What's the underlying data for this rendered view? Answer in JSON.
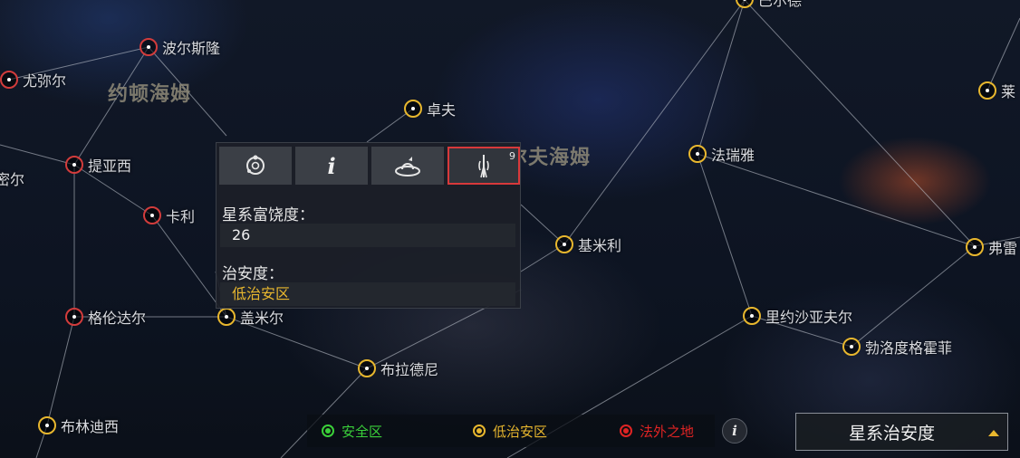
{
  "map": {
    "regions": [
      {
        "id": "r1",
        "name": "约顿海姆"
      },
      {
        "id": "r2",
        "name": "尔夫海姆"
      }
    ],
    "systems": [
      {
        "id": "s-bo",
        "name": "波尔斯隆",
        "security": "red"
      },
      {
        "id": "s-you",
        "name": "尤弥尔",
        "security": "red"
      },
      {
        "id": "s-mi",
        "name": "密尔",
        "security": "none"
      },
      {
        "id": "s-ti",
        "name": "提亚西",
        "security": "red"
      },
      {
        "id": "s-ka",
        "name": "卡利",
        "security": "red"
      },
      {
        "id": "s-ge",
        "name": "格伦达尔",
        "security": "red"
      },
      {
        "id": "s-gai",
        "name": "盖米尔",
        "security": "yellow"
      },
      {
        "id": "s-bulin",
        "name": "布林迪西",
        "security": "yellow"
      },
      {
        "id": "s-zhuo",
        "name": "卓夫",
        "security": "yellow"
      },
      {
        "id": "s-ji",
        "name": "基米利",
        "security": "yellow"
      },
      {
        "id": "s-fa",
        "name": "法瑞雅",
        "security": "yellow"
      },
      {
        "id": "s-li",
        "name": "里约沙亚夫尔",
        "security": "yellow"
      },
      {
        "id": "s-boluo",
        "name": "勃洛度格霍菲",
        "security": "yellow"
      },
      {
        "id": "s-bula",
        "name": "布拉德尼",
        "security": "yellow"
      },
      {
        "id": "s-fu",
        "name": "弗雷",
        "security": "yellow"
      },
      {
        "id": "s-lai",
        "name": "莱",
        "security": "yellow"
      },
      {
        "id": "s-top",
        "name": "巴尔德",
        "security": "yellow"
      }
    ]
  },
  "panel": {
    "tabs": [
      {
        "name": "tab-orbit",
        "icon": "orbit-icon"
      },
      {
        "name": "tab-info",
        "icon": "info-icon",
        "glyph": "i"
      },
      {
        "name": "tab-planet",
        "icon": "planet-icon"
      },
      {
        "name": "tab-security",
        "icon": "signal-tower-icon",
        "badge": "9",
        "active": true
      }
    ],
    "richness_label": "星系富饶度：",
    "richness_value": "26",
    "security_label": "治安度：",
    "security_value": "低治安区"
  },
  "legend": {
    "safe": {
      "label": "安全区",
      "color": "#3ad03a"
    },
    "low": {
      "label": "低治安区",
      "color": "#e8b72e"
    },
    "lawless": {
      "label": "法外之地",
      "color": "#e02424"
    },
    "info_glyph": "i"
  },
  "mode_select": {
    "label": "星系治安度"
  }
}
